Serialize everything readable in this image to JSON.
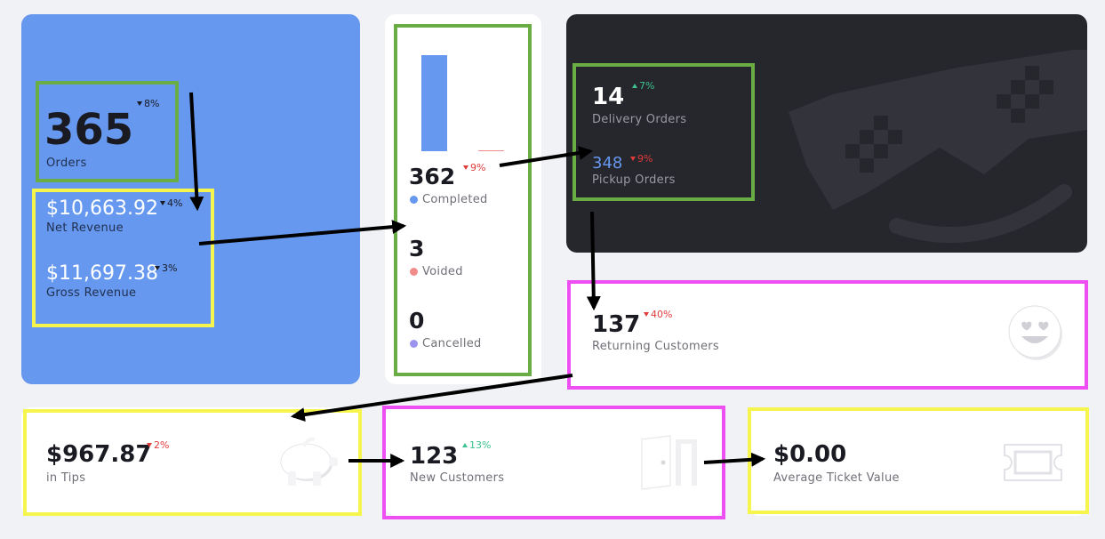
{
  "colors": {
    "blue_card": "#6598ee",
    "dark_card": "#26262d",
    "green_highlight": "#6aad45",
    "yellow_highlight": "#f6f54d",
    "magenta_highlight": "#ee4ff2",
    "completed_dot": "#6598ee",
    "voided_dot": "#f08c8c",
    "cancelled_dot": "#9a94ee",
    "up_delta": "#3ec290",
    "down_delta": "#e03b3b"
  },
  "orders": {
    "value": "365",
    "label": "Orders",
    "delta": "8%",
    "direction": "down"
  },
  "net_revenue": {
    "value": "$10,663.92",
    "label": "Net Revenue",
    "delta": "4%",
    "direction": "down"
  },
  "gross_revenue": {
    "value": "$11,697.38",
    "label": "Gross Revenue",
    "delta": "3%",
    "direction": "down"
  },
  "status": {
    "completed": {
      "value": "362",
      "label": "Completed",
      "delta": "9%",
      "direction": "down"
    },
    "voided": {
      "value": "3",
      "label": "Voided"
    },
    "cancelled": {
      "value": "0",
      "label": "Cancelled"
    },
    "chart_data": {
      "type": "bar",
      "categories": [
        "Completed",
        "Voided",
        "Cancelled"
      ],
      "values": [
        362,
        3,
        0
      ]
    }
  },
  "delivery": {
    "value": "14",
    "label": "Delivery Orders",
    "delta": "7%",
    "direction": "up",
    "pickup_value": "348",
    "pickup_label": "Pickup Orders",
    "pickup_delta": "9%",
    "pickup_direction": "down",
    "decoration_icon": "pixel-sunglasses-smile-icon"
  },
  "returning": {
    "value": "137",
    "label": "Returning Customers",
    "delta": "40%",
    "direction": "down",
    "icon": "heart-eyes-emoji-icon"
  },
  "tips": {
    "value": "$967.87",
    "label": "in Tips",
    "delta": "2%",
    "direction": "down",
    "icon": "piggy-bank-icon"
  },
  "new_customers": {
    "value": "123",
    "label": "New Customers",
    "delta": "13%",
    "direction": "up",
    "icon": "open-door-icon"
  },
  "avg_ticket": {
    "value": "$0.00",
    "label": "Average Ticket Value",
    "icon": "ticket-icon"
  }
}
